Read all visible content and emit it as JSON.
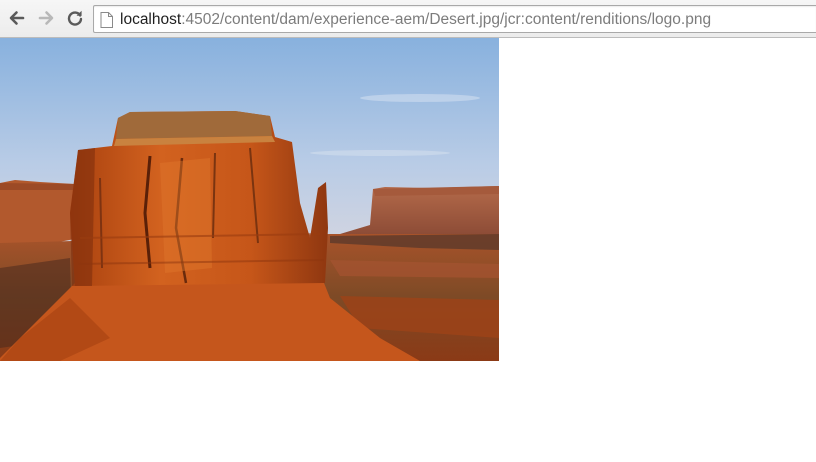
{
  "browser": {
    "url_host": "localhost",
    "url_rest": ":4502/content/dam/experience-aem/Desert.jpg/jcr:content/renditions/logo.png",
    "icons": {
      "back": "back-arrow-icon",
      "forward": "forward-arrow-icon",
      "reload": "reload-icon",
      "page": "page-icon"
    },
    "forward_enabled": false
  },
  "image": {
    "subject": "desert-mesa-photo",
    "colors": {
      "sky_top": "#8fb6df",
      "sky_bottom": "#c9d6e8",
      "rock": "#c9561a",
      "rock_shadow": "#8a3210",
      "ground": "#9a4a1e"
    }
  }
}
